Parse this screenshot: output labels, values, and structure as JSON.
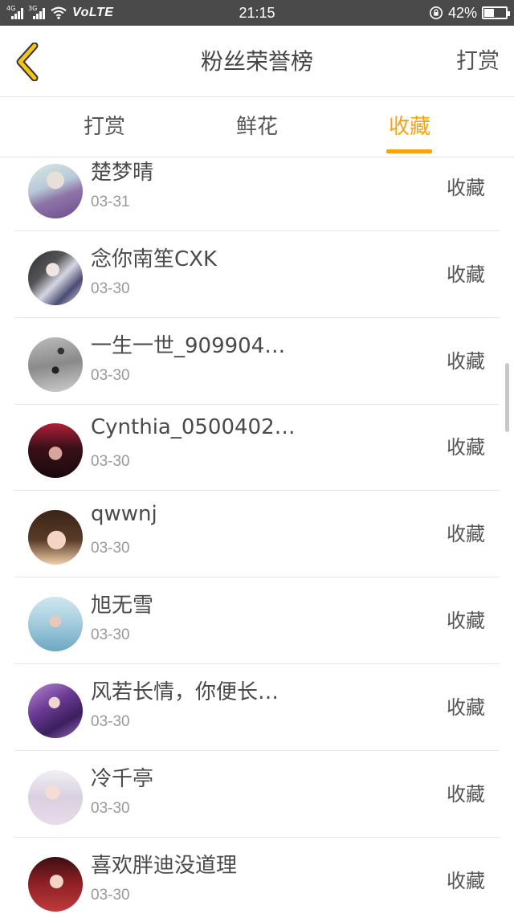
{
  "status_bar": {
    "net1": "4G",
    "net2": "3G",
    "volte": "VoLTE",
    "time": "21:15",
    "battery_pct": "42%",
    "battery_level": 0.42
  },
  "header": {
    "title": "粉丝荣誉榜",
    "right_link": "打赏"
  },
  "tabs": [
    {
      "label": "打赏",
      "active": false
    },
    {
      "label": "鲜花",
      "active": false
    },
    {
      "label": "收藏",
      "active": true
    }
  ],
  "colors": {
    "accent": "#f5a312",
    "back_arrow": "#f5c518",
    "status_bar": "#4a4a4a"
  },
  "rows": [
    {
      "name": "楚梦晴",
      "date": "03-31",
      "action": "收藏"
    },
    {
      "name": "念你南笙CXK",
      "date": "03-30",
      "action": "收藏"
    },
    {
      "name": "一生一世_909904…",
      "date": "03-30",
      "action": "收藏"
    },
    {
      "name": "Cynthia_0500402…",
      "date": "03-30",
      "action": "收藏"
    },
    {
      "name": "qwwnj",
      "date": "03-30",
      "action": "收藏"
    },
    {
      "name": "旭无雪",
      "date": "03-30",
      "action": "收藏"
    },
    {
      "name": "风若长情，你便长…",
      "date": "03-30",
      "action": "收藏"
    },
    {
      "name": "冷千亭",
      "date": "03-30",
      "action": "收藏"
    },
    {
      "name": "喜欢胖迪没道理",
      "date": "03-30",
      "action": "收藏"
    }
  ]
}
